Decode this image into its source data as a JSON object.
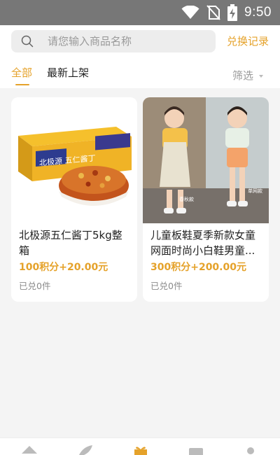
{
  "status_bar": {
    "time": "9:50"
  },
  "search": {
    "placeholder": "请您输入商品名称",
    "value": ""
  },
  "header": {
    "exchange_record": "兑换记录"
  },
  "tabs": [
    {
      "label": "全部",
      "active": true
    },
    {
      "label": "最新上架",
      "active": false
    }
  ],
  "filter": {
    "label": "筛选"
  },
  "products": [
    {
      "title": "北极源五仁酱丁5kg整箱",
      "price": "100积分+20.00元",
      "sold": "已兑0件",
      "image_text": "北极源  五仁酱丁"
    },
    {
      "title": "儿童板鞋夏季新款女童网面时尚小白鞋男童...",
      "price": "300积分+200.00元",
      "sold": "已兑0件",
      "image_text_1": "春秋款",
      "image_text_2": "单网款"
    }
  ],
  "bottom_nav": [
    "home-icon",
    "leaf-icon",
    "gift-icon",
    "chart-icon",
    "user-icon"
  ],
  "colors": {
    "accent": "#e5a22a",
    "status_bar": "#777777",
    "background": "#f4f4f4"
  }
}
